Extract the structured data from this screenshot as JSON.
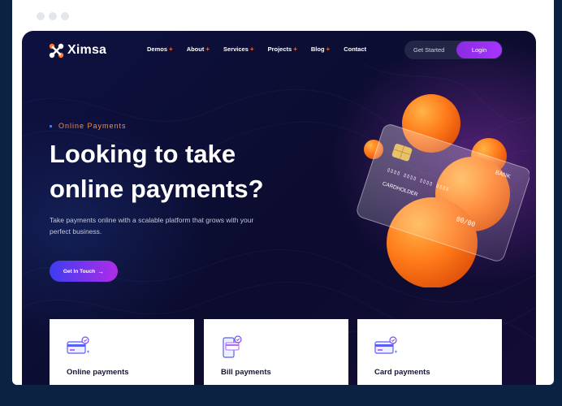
{
  "brand": {
    "name": "Ximsa"
  },
  "nav": {
    "items": [
      {
        "label": "Demos",
        "plus": "+"
      },
      {
        "label": "About",
        "plus": "+"
      },
      {
        "label": "Services",
        "plus": "+"
      },
      {
        "label": "Projects",
        "plus": "+"
      },
      {
        "label": "Blog",
        "plus": "+"
      },
      {
        "label": "Contact",
        "plus": ""
      }
    ],
    "get_started": "Get Started",
    "login": "Login"
  },
  "hero": {
    "eyebrow": "Online Payments",
    "title": "Looking to take online payments?",
    "description": "Take payments online with a scalable platform that grows with your perfect business.",
    "cta": "Get In Touch",
    "cta_arrow": "→"
  },
  "card_art": {
    "holder": "CARDHOLDER",
    "bank": "BANK",
    "expiry": "00/00"
  },
  "features": [
    {
      "title": "Online payments",
      "icon": "credit-card-icon"
    },
    {
      "title": "Bill payments",
      "icon": "mobile-payment-icon"
    },
    {
      "title": "Card payments",
      "icon": "credit-card-icon"
    }
  ],
  "colors": {
    "accent_orange": "#ff6a2a",
    "accent_purple": "#a833ff",
    "hero_bg": "#0b0c2e",
    "page_bg": "#0c2242"
  }
}
